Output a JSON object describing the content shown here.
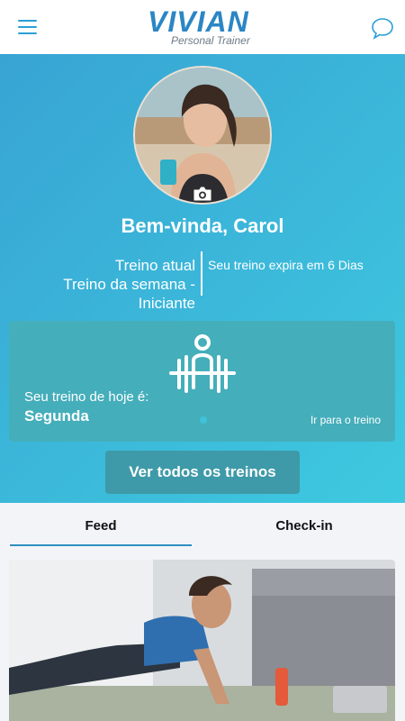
{
  "header": {
    "logo_text": "VIVIAN",
    "logo_subtitle": "Personal Trainer",
    "icons": [
      "menu-icon",
      "chat-icon"
    ]
  },
  "profile": {
    "greeting": "Bem-vinda, Carol",
    "current_workout_label": "Treino atual",
    "current_workout_name": "Treino da semana - Iniciante",
    "expiry_text": "Seu treino expira em 6 Dias"
  },
  "today": {
    "label": "Seu treino de hoje é:",
    "day": "Segunda",
    "link": "Ir para o treino"
  },
  "actions": {
    "all_workouts": "Ver todos os treinos"
  },
  "tabs": [
    {
      "label": "Feed",
      "active": true
    },
    {
      "label": "Check-in",
      "active": false
    }
  ],
  "colors": {
    "accent": "#2a9fd6",
    "hero_start": "#38a4d4",
    "hero_end": "#3ec9df",
    "card": "#45aebb",
    "button": "#3e9aa8"
  }
}
